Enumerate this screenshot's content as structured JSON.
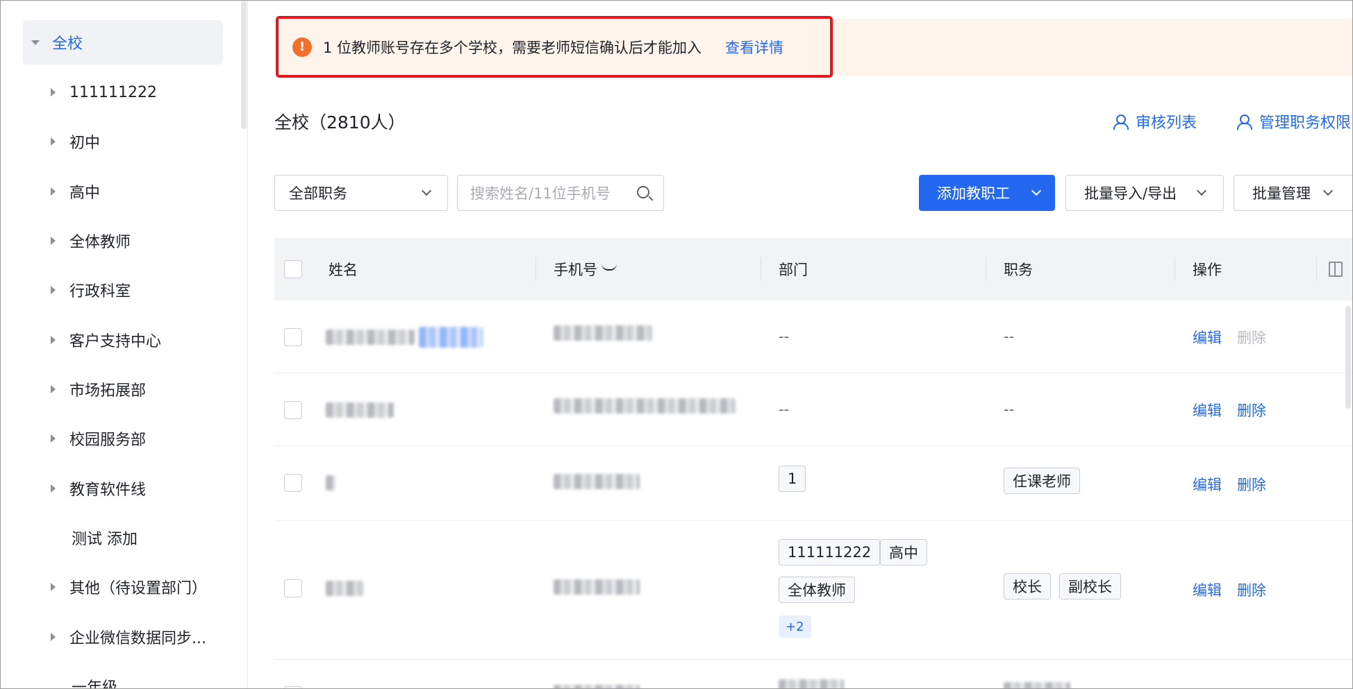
{
  "sidebar": {
    "items": [
      {
        "label": "全校",
        "active": true,
        "expandable": true
      },
      {
        "label": "111111222",
        "expandable": true
      },
      {
        "label": "初中",
        "expandable": true
      },
      {
        "label": "高中",
        "expandable": true
      },
      {
        "label": "全体教师",
        "expandable": true
      },
      {
        "label": "行政科室",
        "expandable": true
      },
      {
        "label": "客户支持中心",
        "expandable": true
      },
      {
        "label": "市场拓展部",
        "expandable": true
      },
      {
        "label": "校园服务部",
        "expandable": true
      },
      {
        "label": "教育软件线",
        "expandable": true
      },
      {
        "label": "测试 添加",
        "expandable": false
      },
      {
        "label": "其他（待设置部门）",
        "expandable": true
      },
      {
        "label": "企业微信数据同步...",
        "expandable": true
      },
      {
        "label": "一年级",
        "expandable": false
      }
    ]
  },
  "alert": {
    "icon": "warning-icon",
    "text": "1 位教师账号存在多个学校，需要老师短信确认后才能加入",
    "link": "查看详情"
  },
  "header": {
    "title": "全校（2810人）",
    "audit_link": "审核列表",
    "permission_link": "管理职务权限"
  },
  "filters": {
    "role_select": "全部职务",
    "search_placeholder": "搜索姓名/11位手机号"
  },
  "buttons": {
    "add_staff": "添加教职工",
    "batch_import_export": "批量导入/导出",
    "batch_manage": "批量管理"
  },
  "table": {
    "columns": {
      "name": "姓名",
      "phone": "手机号",
      "department": "部门",
      "role": "职务",
      "action": "操作"
    },
    "rows": [
      {
        "department_text": "--",
        "role_text": "--",
        "edit": "编辑",
        "delete": "删除"
      },
      {
        "department_text": "--",
        "role_text": "--",
        "edit": "编辑",
        "delete": "删除"
      },
      {
        "departments": [
          "1"
        ],
        "roles": [
          "任课老师"
        ],
        "edit": "编辑",
        "delete": "删除"
      },
      {
        "departments": [
          "111111222",
          "高中",
          "全体教师"
        ],
        "more": "+2",
        "roles": [
          "校长",
          "副校长"
        ],
        "edit": "编辑",
        "delete": "删除"
      }
    ]
  },
  "colors": {
    "primary": "#2468f2",
    "warning": "#f4702a",
    "alert_bg": "#fff4ec",
    "highlight_border": "#e8151b"
  }
}
